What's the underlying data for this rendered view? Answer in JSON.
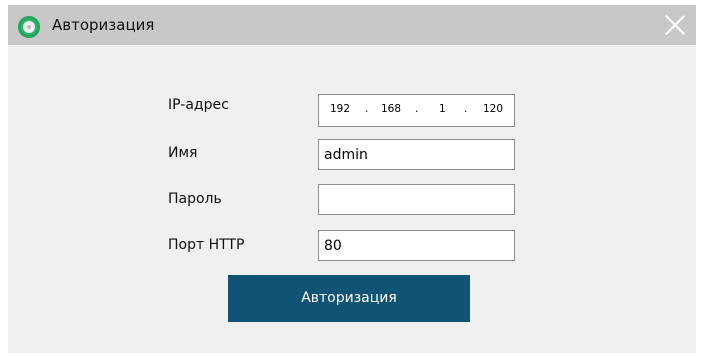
{
  "window": {
    "title": "Авторизация",
    "icon": "app-logo-icon",
    "close_icon": "close-icon"
  },
  "form": {
    "ip_label": "IP-адрес",
    "ip": {
      "oct1": "192",
      "oct2": "168",
      "oct3": "1",
      "oct4": "120",
      "sep": "."
    },
    "name_label": "Имя",
    "name_value": "admin",
    "password_label": "Пароль",
    "password_value": "",
    "port_label": "Порт HTTP",
    "port_value": "80",
    "submit_label": "Авторизация"
  },
  "colors": {
    "titlebar": "#c8c8c8",
    "button": "#0f5474",
    "icon": "#2db56a"
  }
}
